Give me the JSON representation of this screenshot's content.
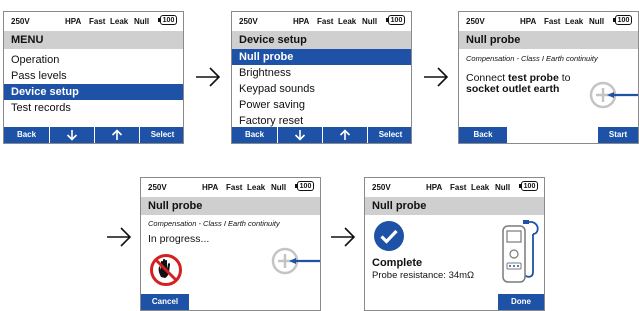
{
  "status": {
    "voltage": "250V",
    "hpa": "HPA",
    "fast": "Fast",
    "leak": "Leak",
    "null": "Null",
    "battery": "100"
  },
  "screen1": {
    "title": "MENU",
    "items": [
      "Operation",
      "Pass levels",
      "Device setup",
      "Test records"
    ],
    "selected_index": 2,
    "buttons": {
      "back": "Back",
      "down": "down-arrow-icon",
      "up": "up-arrow-icon",
      "select": "Select"
    }
  },
  "screen2": {
    "title": "Device setup",
    "items": [
      "Null probe",
      "Brightness",
      "Keypad sounds",
      "Power saving",
      "Factory reset"
    ],
    "selected_index": 0,
    "buttons": {
      "back": "Back",
      "down": "down-arrow-icon",
      "up": "up-arrow-icon",
      "select": "Select"
    }
  },
  "screen3": {
    "title": "Null probe",
    "subtitle": "Compensation - Class I Earth continuity",
    "msg_a": "Connect ",
    "msg_b": "test probe",
    "msg_c": " to",
    "msg_line2": "socket outlet earth",
    "back": "Back",
    "start": "Start"
  },
  "screen4": {
    "title": "Null probe",
    "subtitle": "Compensation - Class I Earth continuity",
    "progress": "In progress...",
    "cancel": "Cancel"
  },
  "screen5": {
    "title": "Null probe",
    "complete": "Complete",
    "result": "Probe resistance: 34mΩ",
    "done": "Done"
  },
  "colors": {
    "accent": "#1d52a6",
    "titlebar": "#cfcfcf",
    "stop": "#d42020"
  }
}
